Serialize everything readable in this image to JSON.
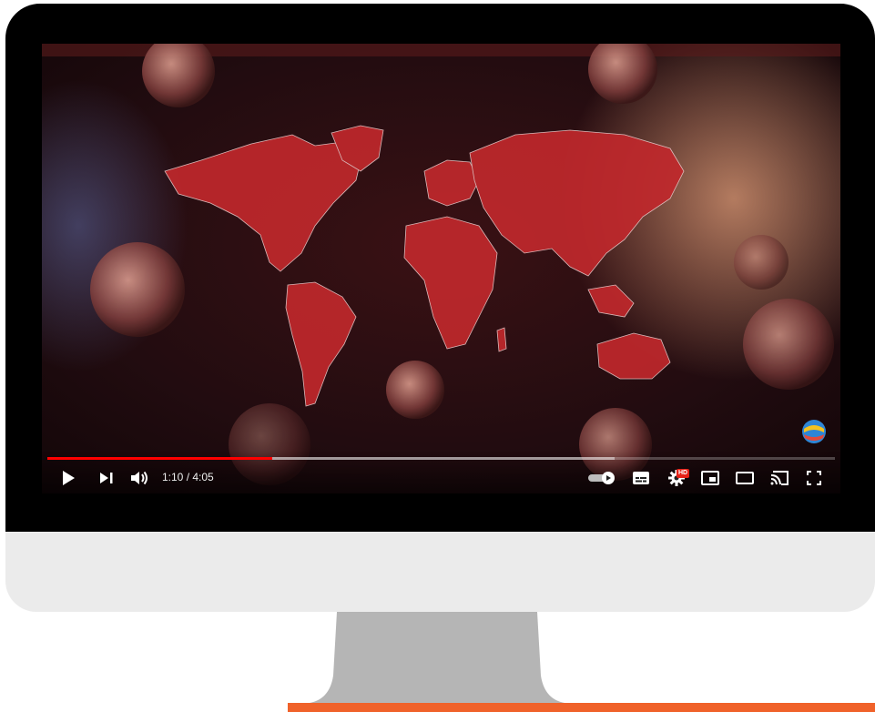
{
  "player": {
    "time_display": "1:10 / 4:05",
    "progress_fraction": 0.286,
    "buffered_fraction": 0.72,
    "hd_badge": "HD",
    "icons": {
      "play": "play-icon",
      "next": "next-icon",
      "volume": "volume-icon",
      "autoplay": "autoplay-toggle-icon",
      "subtitles": "subtitles-icon",
      "settings": "gear-icon",
      "miniplayer": "miniplayer-icon",
      "theater": "theater-mode-icon",
      "cast": "cast-icon",
      "fullscreen": "fullscreen-icon"
    },
    "colors": {
      "progress": "#ff0000",
      "accent": "#f0622a",
      "map": "#c0282c"
    }
  }
}
